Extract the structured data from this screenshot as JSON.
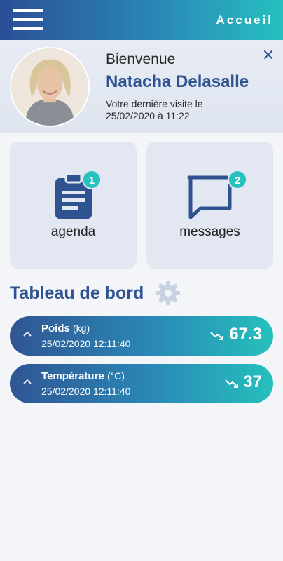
{
  "header": {
    "title": "Accueil"
  },
  "welcome": {
    "greeting": "Bienvenue",
    "name": "Natacha Delasalle",
    "last_visit_line1": "Votre dernière visite le",
    "last_visit_line2": "25/02/2020 à 11:22"
  },
  "tiles": [
    {
      "label": "agenda",
      "badge": "1",
      "icon": "clipboard-icon"
    },
    {
      "label": "messages",
      "badge": "2",
      "icon": "chat-bubble-icon"
    }
  ],
  "dashboard": {
    "title": "Tableau de bord",
    "metrics": [
      {
        "name": "Poids",
        "unit": "(kg)",
        "date": "25/02/2020 12:11:40",
        "value": "67.3",
        "trend": "down"
      },
      {
        "name": "Température",
        "unit": "(°C)",
        "date": "25/02/2020 12:11:40",
        "value": "37",
        "trend": "down"
      }
    ]
  },
  "colors": {
    "brand_blue": "#2e5390",
    "accent_teal": "#27c2c0",
    "tile_bg": "#e3e7f1"
  }
}
